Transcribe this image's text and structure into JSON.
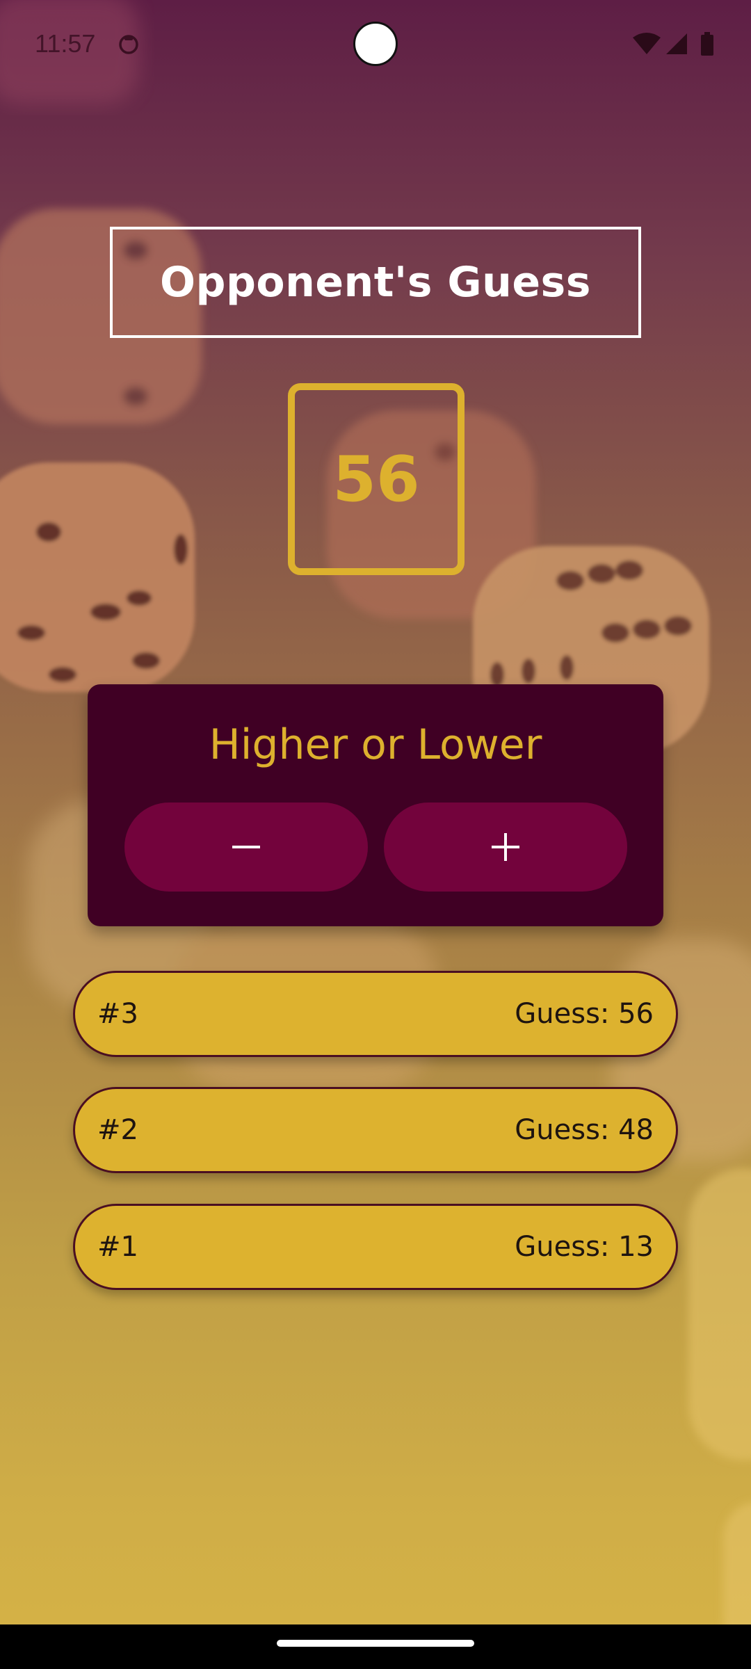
{
  "status_bar": {
    "time": "11:57",
    "icons": [
      "app-notification-icon",
      "wifi-icon",
      "cellular-signal-icon",
      "battery-icon"
    ]
  },
  "screen": {
    "title": "Opponent's Guess",
    "current_guess": "56"
  },
  "control": {
    "label": "Higher or Lower",
    "lower_button": "minus-icon",
    "higher_button": "plus-icon"
  },
  "guess_log": [
    {
      "round": "#3",
      "text": "Guess: 56"
    },
    {
      "round": "#2",
      "text": "Guess: 48"
    },
    {
      "round": "#1",
      "text": "Guess: 13"
    }
  ],
  "colors": {
    "accent_gold": "#ddb12e",
    "card_dark": "#400024",
    "button_magenta": "#73033c",
    "title_border": "#ffffff"
  }
}
